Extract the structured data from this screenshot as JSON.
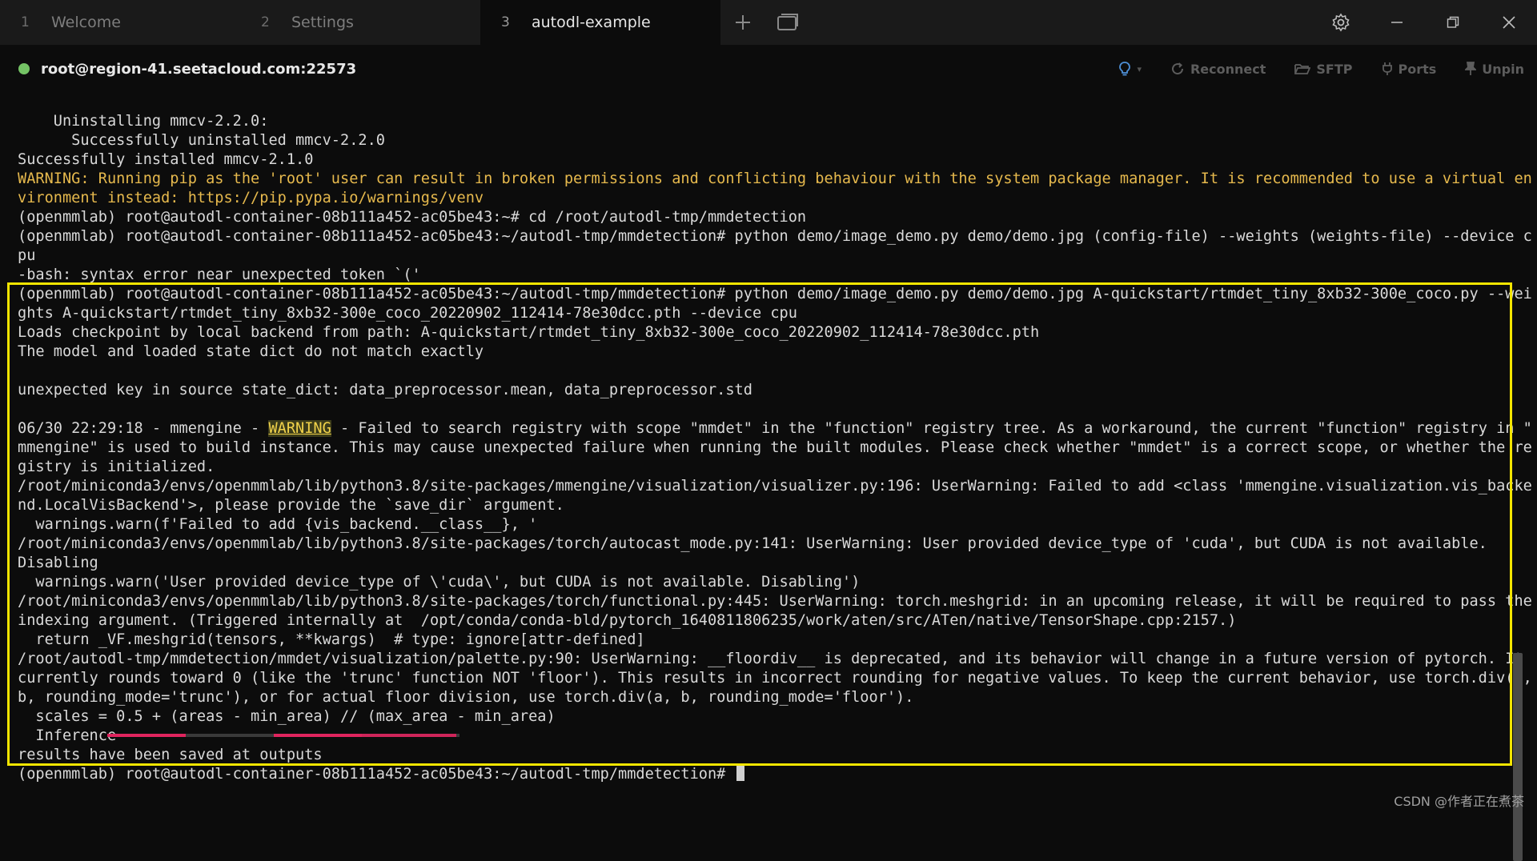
{
  "tabs": [
    {
      "num": "1",
      "label": "Welcome"
    },
    {
      "num": "2",
      "label": "Settings"
    },
    {
      "num": "3",
      "label": "autodl-example"
    }
  ],
  "session": {
    "host": "root@region-41.seetacloud.com:22573",
    "status_color": "#74c365",
    "actions": {
      "reconnect": "Reconnect",
      "sftp": "SFTP",
      "ports": "Ports",
      "unpin": "Unpin"
    }
  },
  "terminal": {
    "lines": [
      "    Uninstalling mmcv-2.2.0:",
      "      Successfully uninstalled mmcv-2.2.0",
      "Successfully installed mmcv-2.1.0",
      "WARNING: Running pip as the 'root' user can result in broken permissions and conflicting behaviour with the system package manager. It is recommended to use a virtual en",
      "vironment instead: https://pip.pypa.io/warnings/venv",
      "(openmmlab) root@autodl-container-08b111a452-ac05be43:~# cd /root/autodl-tmp/mmdetection",
      "(openmmlab) root@autodl-container-08b111a452-ac05be43:~/autodl-tmp/mmdetection# python demo/image_demo.py demo/demo.jpg (config-file) --weights (weights-file) --device c",
      "pu",
      "-bash: syntax error near unexpected token `('",
      "(openmmlab) root@autodl-container-08b111a452-ac05be43:~/autodl-tmp/mmdetection# python demo/image_demo.py demo/demo.jpg A-quickstart/rtmdet_tiny_8xb32-300e_coco.py --wei",
      "ghts A-quickstart/rtmdet_tiny_8xb32-300e_coco_20220902_112414-78e30dcc.pth --device cpu",
      "Loads checkpoint by local backend from path: A-quickstart/rtmdet_tiny_8xb32-300e_coco_20220902_112414-78e30dcc.pth",
      "The model and loaded state dict do not match exactly",
      "",
      "unexpected key in source state_dict: data_preprocessor.mean, data_preprocessor.std",
      "",
      "",
      "mmengine\" is used to build instance. This may cause unexpected failure when running the built modules. Please check whether \"mmdet\" is a correct scope, or whether the re",
      "gistry is initialized.",
      "/root/miniconda3/envs/openmmlab/lib/python3.8/site-packages/mmengine/visualization/visualizer.py:196: UserWarning: Failed to add <class 'mmengine.visualization.vis_backe",
      "nd.LocalVisBackend'>, please provide the `save_dir` argument.",
      "  warnings.warn(f'Failed to add {vis_backend.__class__}, '",
      "/root/miniconda3/envs/openmmlab/lib/python3.8/site-packages/torch/autocast_mode.py:141: UserWarning: User provided device_type of 'cuda', but CUDA is not available.",
      "Disabling",
      "  warnings.warn('User provided device_type of \\'cuda\\', but CUDA is not available. Disabling')",
      "/root/miniconda3/envs/openmmlab/lib/python3.8/site-packages/torch/functional.py:445: UserWarning: torch.meshgrid: in an upcoming release, it will be required to pass the",
      "indexing argument. (Triggered internally at  /opt/conda/conda-bld/pytorch_1640811806235/work/aten/src/ATen/native/TensorShape.cpp:2157.)",
      "  return _VF.meshgrid(tensors, **kwargs)  # type: ignore[attr-defined]",
      "/root/autodl-tmp/mmdetection/mmdet/visualization/palette.py:90: UserWarning: __floordiv__ is deprecated, and its behavior will change in a future version of pytorch. It",
      "currently rounds toward 0 (like the 'trunc' function NOT 'floor'). This results in incorrect rounding for negative values. To keep the current behavior, use torch.div(a,",
      "b, rounding_mode='trunc'), or for actual floor division, use torch.div(a, b, rounding_mode='floor').",
      "  scales = 0.5 + (areas - min_area) // (max_area - min_area)",
      "  Inference",
      "results have been saved at outputs",
      "(openmmlab) root@autodl-container-08b111a452-ac05be43:~/autodl-tmp/mmdetection# "
    ],
    "mmengine_line": {
      "prefix": "06/30 22:29:18 - mmengine - ",
      "level": "WARNING",
      "suffix": " - Failed to search registry with scope \"mmdet\" in the \"function\" registry tree. As a workaround, the current \"function\" registry in \""
    },
    "warning_color": "#e6b94d",
    "progress_bar_color": "#e0245e"
  },
  "watermark": "CSDN @作者正在煮茶"
}
